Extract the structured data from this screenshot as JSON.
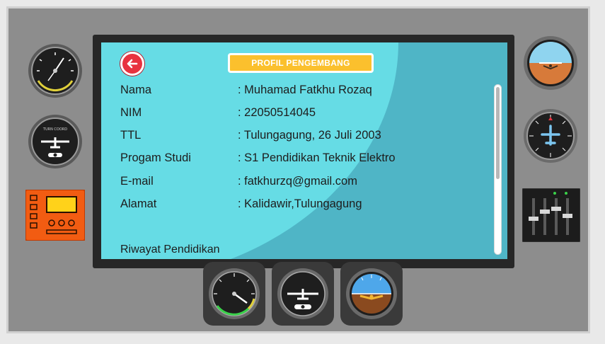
{
  "header": {
    "title": "PROFIL PENGEMBANG"
  },
  "profile": {
    "rows": [
      {
        "label": "Nama",
        "value": ": Muhamad Fatkhu Rozaq"
      },
      {
        "label": "NIM",
        "value": ": 22050514045"
      },
      {
        "label": "TTL",
        "value": ": Tulungagung, 26 Juli 2003"
      },
      {
        "label": "Progam Studi",
        "value": ": S1 Pendidikan Teknik Elektro"
      },
      {
        "label": "E-mail",
        "value": ": fatkhurzq@gmail.com"
      },
      {
        "label": "Alamat",
        "value": ": Kalidawir,Tulungagung"
      }
    ],
    "section_heading": "Riwayat Pendidikan"
  },
  "icons": {
    "back": "arrow-left-icon",
    "left_gauges": [
      "altimeter-icon",
      "turn-coordinator-icon",
      "radio-panel-icon"
    ],
    "right_gauges": [
      "attitude-indicator-icon",
      "heading-indicator-icon",
      "throttle-panel-icon"
    ],
    "bottom_gauges": [
      "airspeed-indicator-icon",
      "turn-slip-indicator-icon",
      "artificial-horizon-icon"
    ]
  },
  "colors": {
    "panel": "#8d8d8d",
    "screen_light": "#66dce5",
    "screen_dark": "#4fb5c6",
    "back_button": "#e8323f",
    "title_badge": "#fbc02d"
  }
}
